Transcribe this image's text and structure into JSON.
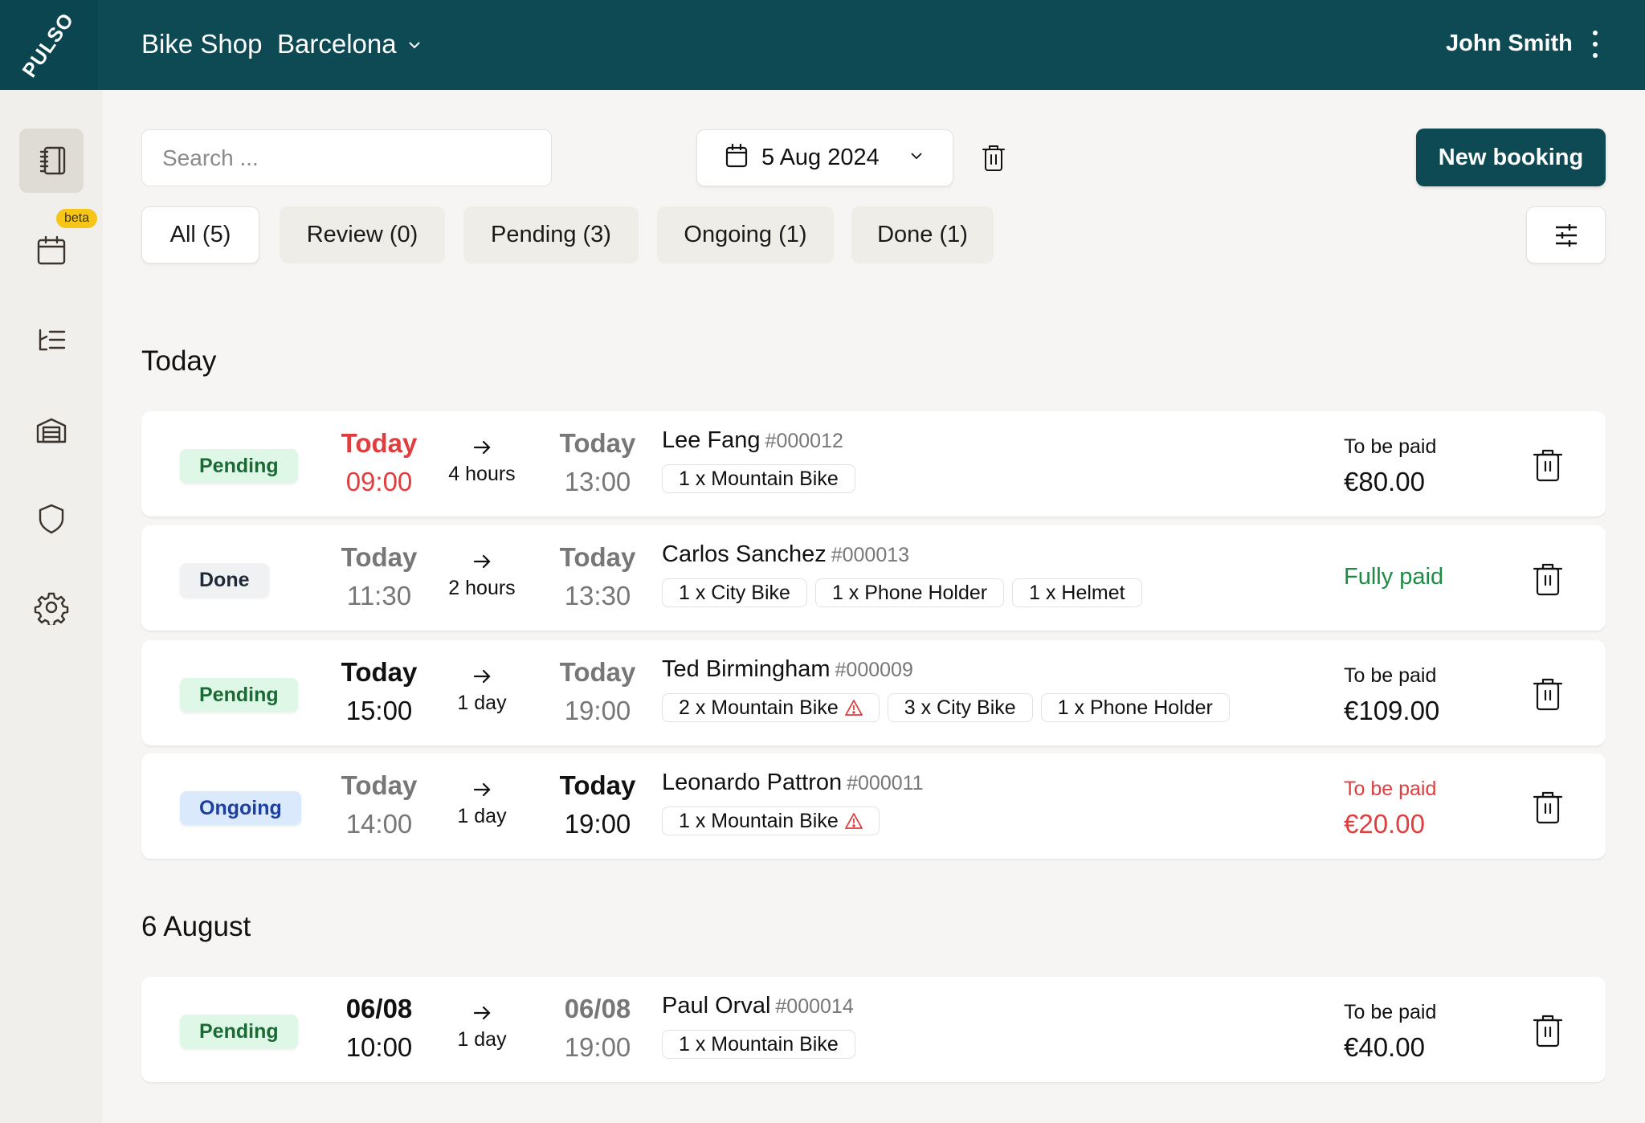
{
  "header": {
    "logo": "PULSO",
    "shop_name": "Bike Shop",
    "location": "Barcelona",
    "user_name": "John Smith"
  },
  "sidebar": {
    "items": [
      {
        "id": "bookings",
        "icon": "notebook-icon",
        "active": true
      },
      {
        "id": "calendar",
        "icon": "calendar-icon",
        "badge": "beta"
      },
      {
        "id": "inventory-list",
        "icon": "list-tree-icon"
      },
      {
        "id": "warehouse",
        "icon": "garage-icon"
      },
      {
        "id": "security",
        "icon": "shield-icon"
      },
      {
        "id": "settings",
        "icon": "gear-icon"
      }
    ],
    "beta_badge": "beta"
  },
  "toolbar": {
    "search_placeholder": "Search ...",
    "date": "5 Aug 2024",
    "new_booking": "New booking"
  },
  "tabs": [
    {
      "label": "All (5)",
      "active": true
    },
    {
      "label": "Review (0)"
    },
    {
      "label": "Pending (3)"
    },
    {
      "label": "Ongoing (1)"
    },
    {
      "label": "Done (1)"
    }
  ],
  "sections": [
    {
      "title": "Today",
      "bookings": [
        {
          "status": "Pending",
          "start_day": "Today",
          "start_time": "09:00",
          "duration": "4 hours",
          "end_day": "Today",
          "end_time": "13:00",
          "customer": "Lee Fang",
          "ref": "#000012",
          "items": [
            {
              "label": "1 x Mountain Bike"
            }
          ],
          "payment_label": "To be paid",
          "payment_amount": "€80.00"
        },
        {
          "status": "Done",
          "start_day": "Today",
          "start_time": "11:30",
          "duration": "2 hours",
          "end_day": "Today",
          "end_time": "13:30",
          "customer": "Carlos Sanchez",
          "ref": "#000013",
          "items": [
            {
              "label": "1 x City Bike"
            },
            {
              "label": "1 x Phone Holder"
            },
            {
              "label": "1 x Helmet"
            }
          ],
          "payment_label": "Fully paid"
        },
        {
          "status": "Pending",
          "start_day": "Today",
          "start_time": "15:00",
          "duration": "1 day",
          "end_day": "Today",
          "end_time": "19:00",
          "customer": "Ted Birmingham",
          "ref": "#000009",
          "items": [
            {
              "label": "2 x Mountain Bike",
              "warning": true
            },
            {
              "label": "3 x City Bike"
            },
            {
              "label": "1 x Phone Holder"
            }
          ],
          "payment_label": "To be paid",
          "payment_amount": "€109.00"
        },
        {
          "status": "Ongoing",
          "start_day": "Today",
          "start_time": "14:00",
          "duration": "1 day",
          "end_day": "Today",
          "end_time": "19:00",
          "customer": "Leonardo Pattron",
          "ref": "#000011",
          "items": [
            {
              "label": "1 x Mountain Bike",
              "warning": true
            }
          ],
          "payment_label": "To be paid",
          "payment_amount": "€20.00"
        }
      ]
    },
    {
      "title": "6 August",
      "bookings": [
        {
          "status": "Pending",
          "start_day": "06/08",
          "start_time": "10:00",
          "duration": "1 day",
          "end_day": "06/08",
          "end_time": "19:00",
          "customer": "Paul Orval",
          "ref": "#000014",
          "items": [
            {
              "label": "1 x Mountain Bike"
            }
          ],
          "payment_label": "To be paid",
          "payment_amount": "€40.00"
        }
      ]
    }
  ],
  "colors": {
    "brand": "#0d4a54",
    "overdue_red": "#e03e3e",
    "paid_green": "#1e8a43",
    "pending_bg": "#dff7e6",
    "ongoing_bg": "#dbe9fd",
    "beta_yellow": "#f5c518"
  }
}
